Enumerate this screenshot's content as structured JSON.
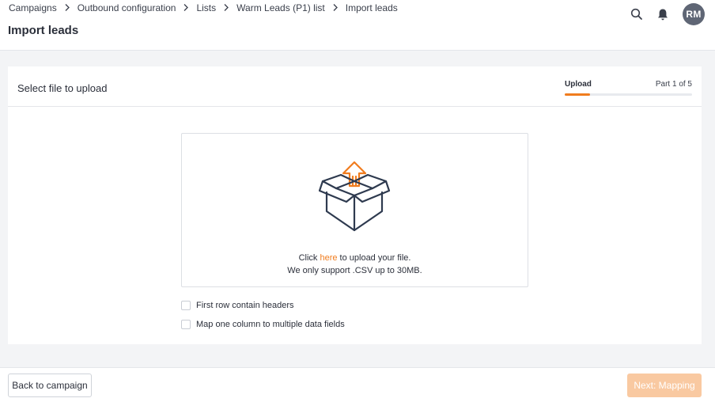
{
  "breadcrumb": [
    "Campaigns",
    "Outbound configuration",
    "Lists",
    "Warm Leads (P1) list",
    "Import leads"
  ],
  "header": {
    "title": "Import leads",
    "avatar_initials": "RM",
    "icons": [
      "search-icon",
      "bell-icon"
    ]
  },
  "card": {
    "title": "Select file to upload",
    "stepper": {
      "step_name": "Upload",
      "part_label": "Part 1 of 5",
      "progress_fraction": 0.2
    }
  },
  "dropzone": {
    "icon": "upload-box-icon",
    "line1_prefix": "Click ",
    "line1_link": "here",
    "line1_suffix": " to upload your file.",
    "line2": "We only support .CSV up to 30MB."
  },
  "options": [
    {
      "label": "First row contain headers",
      "checked": false
    },
    {
      "label": "Map one column to multiple data fields",
      "checked": false
    }
  ],
  "footer": {
    "back_label": "Back to campaign",
    "next_label": "Next: Mapping"
  },
  "colors": {
    "accent": "#f07c1e",
    "accent_disabled": "#f9c9a1",
    "icon_outline": "#2e3a4f"
  }
}
